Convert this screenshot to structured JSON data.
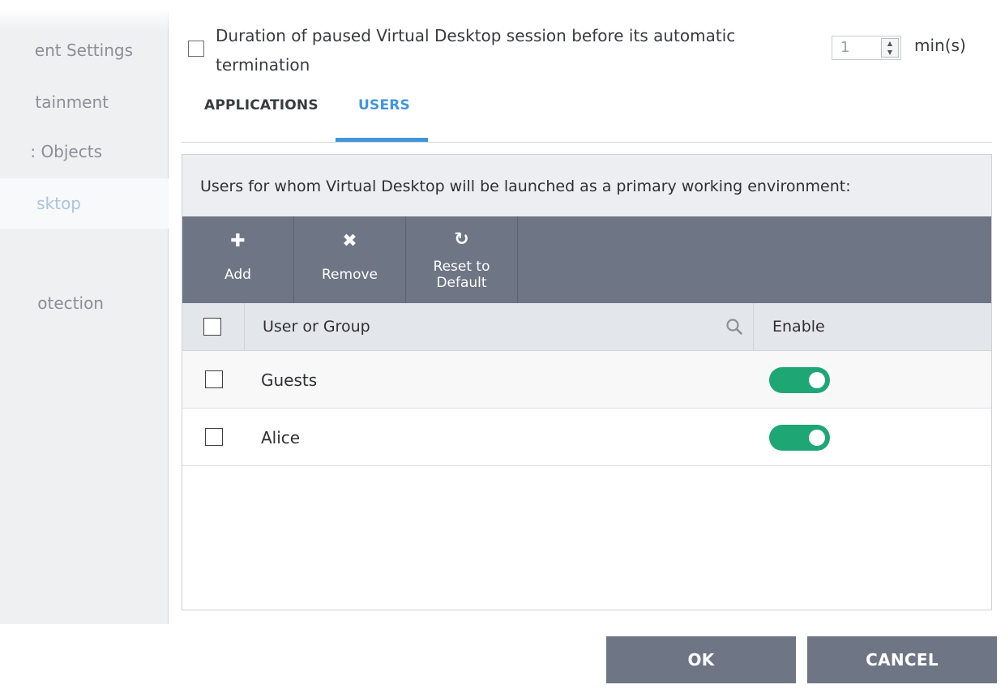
{
  "sidebar": {
    "items": [
      {
        "label": "ent Settings"
      },
      {
        "label": "tainment"
      },
      {
        "label": ": Objects"
      },
      {
        "label": "sktop"
      },
      {
        "label": "otection"
      }
    ]
  },
  "duration": {
    "label": "Duration of paused Virtual Desktop session before its automatic termination",
    "value": "1",
    "unit": "min(s)"
  },
  "tabs": [
    {
      "label": "APPLICATIONS",
      "active": false
    },
    {
      "label": "USERS",
      "active": true
    }
  ],
  "panel": {
    "description": "Users for whom Virtual Desktop will be launched as a primary working environment:"
  },
  "toolbar": {
    "add_label": "Add",
    "remove_label": "Remove",
    "reset_label_line1": "Reset to",
    "reset_label_line2": "Default"
  },
  "table": {
    "columns": [
      "User or Group",
      "Enable"
    ],
    "rows": [
      {
        "name": "Guests",
        "enabled": true
      },
      {
        "name": "Alice",
        "enabled": true
      }
    ]
  },
  "buttons": {
    "ok_label": "OK",
    "cancel_label": "CANCEL"
  },
  "colors": {
    "accent": "#3f96dd",
    "toolbar": "#6e7585",
    "toggle_on": "#1ea774"
  }
}
